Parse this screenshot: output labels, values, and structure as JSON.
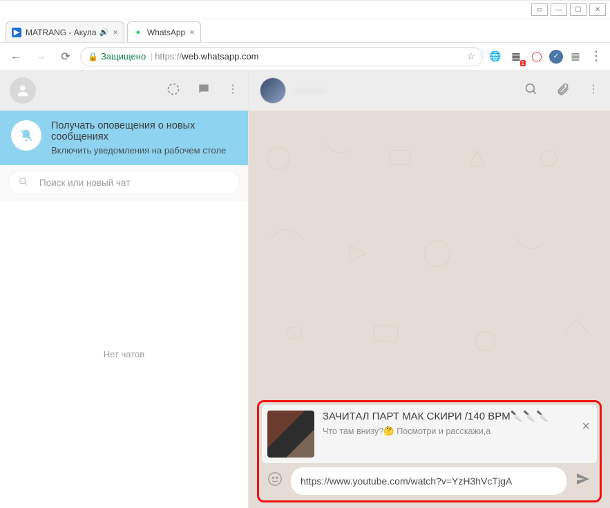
{
  "window": {
    "tb_icons": {
      "pop": "▭",
      "min": "—",
      "max": "☐",
      "close": "✕"
    }
  },
  "tabs": [
    {
      "title": "MATRANG - Акула",
      "audio": true,
      "active": false
    },
    {
      "title": "WhatsApp",
      "audio": false,
      "active": true
    }
  ],
  "address_bar": {
    "secure_label": "Защищено",
    "url_scheme": "https://",
    "url_rest": "web.whatsapp.com"
  },
  "sidebar": {
    "notif_title": "Получать оповещения о новых сообщениях",
    "notif_sub": "Включить уведомления на рабочем столе",
    "search_placeholder": "Поиск или новый чат",
    "empty_label": "Нет чатов"
  },
  "chat": {
    "contact_name": "———"
  },
  "composer": {
    "preview_title": "ЗАЧИТАЛ ПАРТ МАК СКИРИ /140 BPM🔪🔪🔪",
    "preview_sub": "Что там внизу?🤔 Посмотри и расскажи,a",
    "input_value": "https://www.youtube.com/watch?v=YzH3hVcTjgA"
  }
}
